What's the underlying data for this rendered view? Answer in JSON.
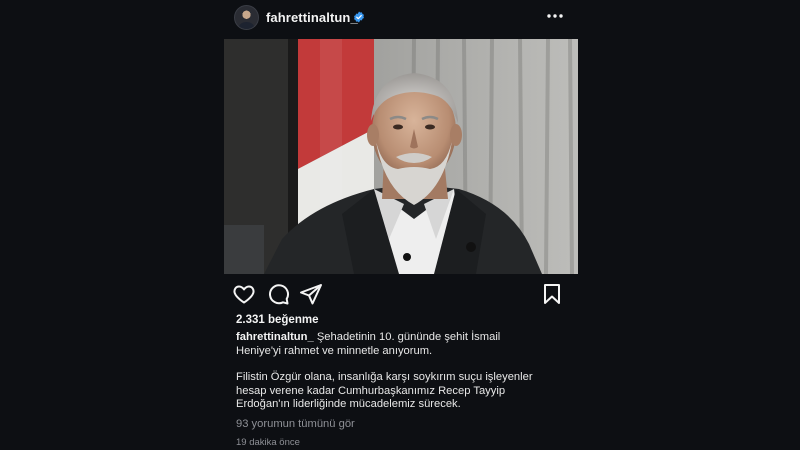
{
  "post": {
    "username": "fahrettinaltun_",
    "verified": true,
    "likes": "2.331 beğenme",
    "caption": {
      "username": "fahrettinaltun_",
      "line1": "Şehadetinin 10. gününde şehit İsmail",
      "line2": "Heniye'yi rahmet ve minnetle anıyorum.",
      "line3": "Filistin Özgür olana, insanlığa karşı soykırım suçu işleyenler",
      "line4": "hesap verene kadar Cumhurbaşkanımız Recep Tayyip",
      "line5": "Erdoğan'ın liderliğinde mücadelemiz sürecek."
    },
    "view_comments": "93 yorumun tümünü gör",
    "timestamp": "19 dakika önce"
  },
  "icons": {
    "more": "more-horizontal-icon",
    "like": "heart-icon",
    "comment": "comment-icon",
    "share": "paper-plane-icon",
    "save": "bookmark-icon",
    "verified": "verified-badge-icon"
  },
  "colors": {
    "background": "#0d0f13",
    "text": "#f4f4f4",
    "muted": "#8e9096",
    "verified": "#3897f0"
  }
}
